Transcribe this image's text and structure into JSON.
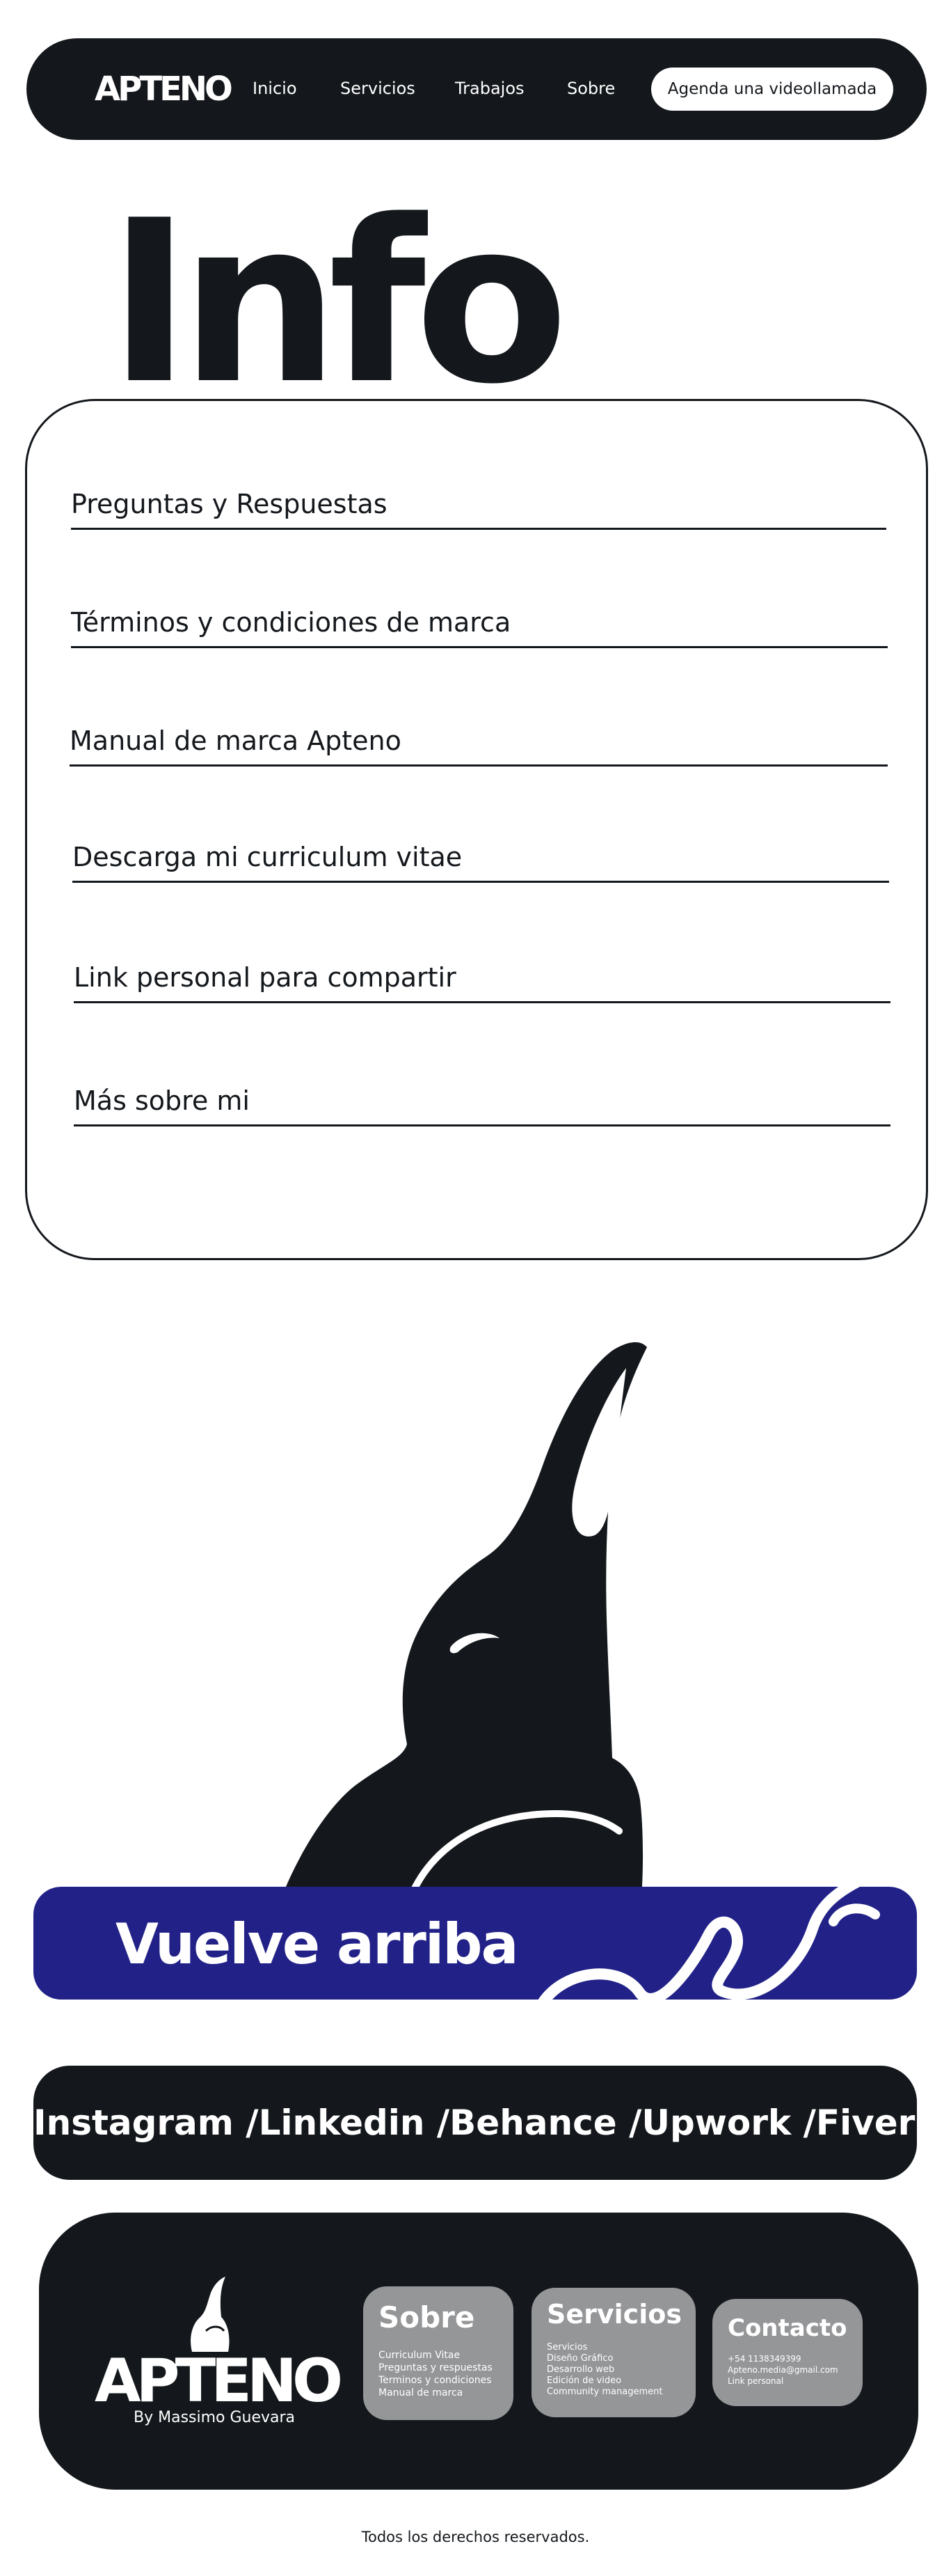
{
  "nav": {
    "logo": "APTENO",
    "links": [
      "Inicio",
      "Servicios",
      "Trabajos",
      "Sobre"
    ],
    "cta": "Agenda una videollamada"
  },
  "info": {
    "heading": "Info",
    "items": [
      "Preguntas y Respuestas",
      "Términos y condiciones de marca",
      "Manual de marca Apteno",
      "Descarga mi curriculum vitae",
      "Link personal para compartir",
      "Más sobre mi"
    ]
  },
  "back_to_top": {
    "label": "Vuelve arriba"
  },
  "social": {
    "links": [
      "Instagram /",
      "Linkedin /",
      "Behance /",
      "Upwork /",
      "Fiverr"
    ]
  },
  "footer": {
    "logo": "APTENO",
    "byline": "By Massimo Guevara",
    "sobre": {
      "title": "Sobre",
      "items": [
        "Curriculum Vitae",
        "Preguntas y respuestas",
        "Terminos y condiciones",
        "Manual de marca"
      ]
    },
    "servicios": {
      "title": "Servicios",
      "items": [
        "Servicios",
        "Diseño Gráfico",
        "Desarrollo web",
        "Edición de video",
        "Community management"
      ]
    },
    "contacto": {
      "title": "Contacto",
      "items": [
        "+54 1138349399",
        "Apteno.media@gmail.com",
        "Link personal"
      ]
    }
  },
  "copyright": "Todos los derechos reservados.",
  "colors": {
    "dark": "#14181c",
    "accent_blue": "#222188",
    "card_gray": "#959698",
    "white": "#ffffff"
  }
}
